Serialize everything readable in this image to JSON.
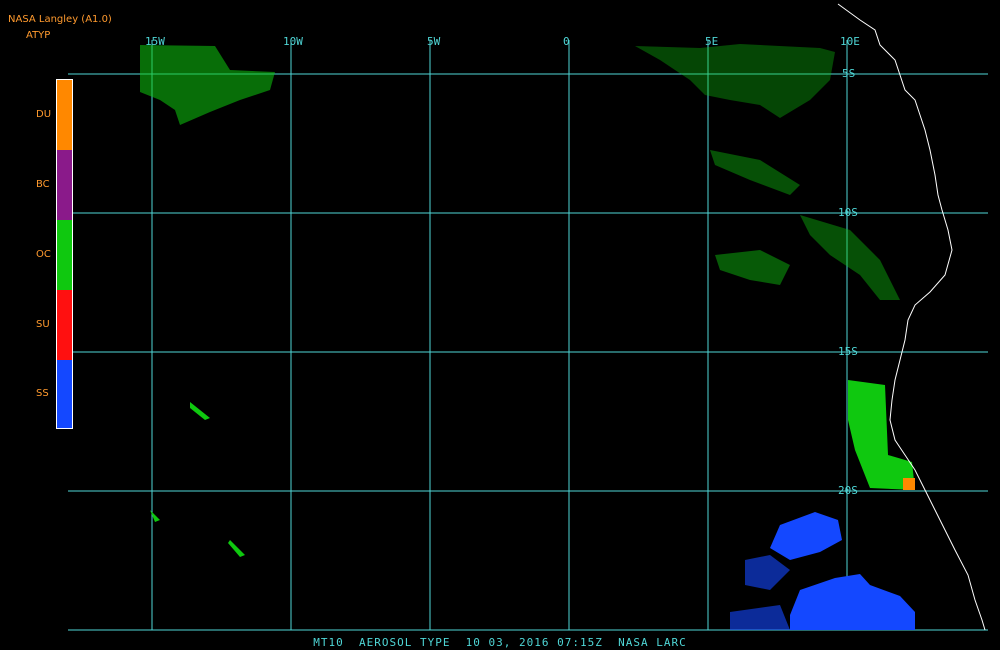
{
  "header": {
    "title": "NASA Langley (A1.0)",
    "subtitle": "ATYP"
  },
  "legend": {
    "items": [
      {
        "label": "DU",
        "color": "#ff8800"
      },
      {
        "label": "BC",
        "color": "#8a1a8a"
      },
      {
        "label": "OC",
        "color": "#0fc80f"
      },
      {
        "label": "SU",
        "color": "#ff1010"
      },
      {
        "label": "SS",
        "color": "#1448ff"
      }
    ]
  },
  "grid": {
    "color": "#4fd6d6",
    "lon_labels": [
      "15W",
      "10W",
      "5W",
      "0",
      "5E",
      "10E"
    ],
    "lat_labels": [
      "5S",
      "10S",
      "15S",
      "20S"
    ]
  },
  "footer": {
    "text": "MT10  AEROSOL TYPE  10 03, 2016 07:15Z  NASA LARC"
  },
  "colors": {
    "background": "#000000",
    "coast": "#ffffff",
    "organic_carbon": "#0fc80f",
    "sea_salt": "#1448ff",
    "dust": "#ff8800"
  }
}
